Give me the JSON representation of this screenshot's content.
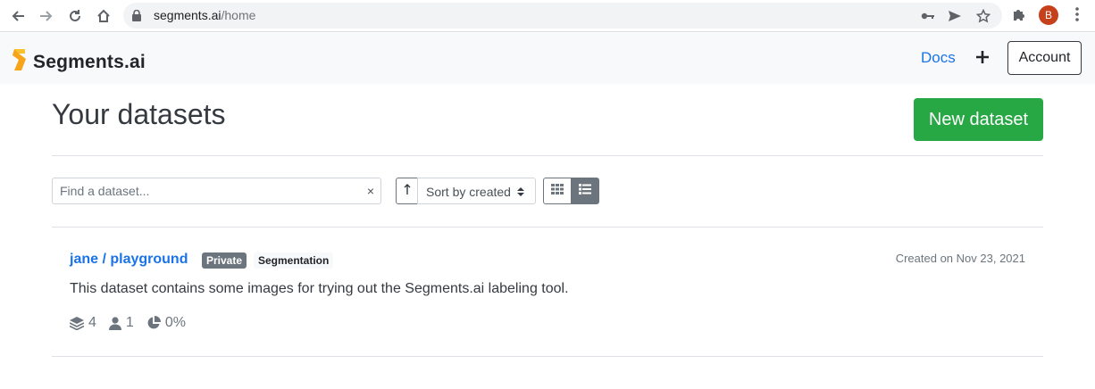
{
  "browser": {
    "url_host": "segments.ai",
    "url_path": "/home",
    "profile_initial": "B"
  },
  "navbar": {
    "brand": "Segments.ai",
    "docs_label": "Docs",
    "account_label": "Account"
  },
  "main": {
    "title": "Your datasets",
    "new_dataset_label": "New dataset",
    "search": {
      "placeholder": "Find a dataset...",
      "clear_label": "×"
    },
    "sort": {
      "direction_glyph": "↑",
      "selected": "Sort by created",
      "caret": "⬍"
    }
  },
  "datasets": [
    {
      "name": "jane / playground",
      "visibility_badge": "Private",
      "task_badge": "Segmentation",
      "created": "Created on Nov 23, 2021",
      "description": "This dataset contains some images for trying out the Segments.ai labeling tool.",
      "samples": "4",
      "collaborators": "1",
      "progress": "0%"
    }
  ],
  "colors": {
    "accent": "#1a73e8",
    "success": "#28a745",
    "secondary": "#6c757d",
    "brand_orange": "#f7a418"
  },
  "icons": [
    "back-icon",
    "forward-icon",
    "reload-icon",
    "home-icon",
    "lock-icon",
    "key-icon",
    "send-icon",
    "star-icon",
    "puzzle-icon",
    "kebab-icon",
    "logo-icon",
    "plus-icon",
    "sort-arrow-icon",
    "grid-icon",
    "list-icon",
    "layers-icon",
    "user-icon",
    "pie-icon"
  ]
}
